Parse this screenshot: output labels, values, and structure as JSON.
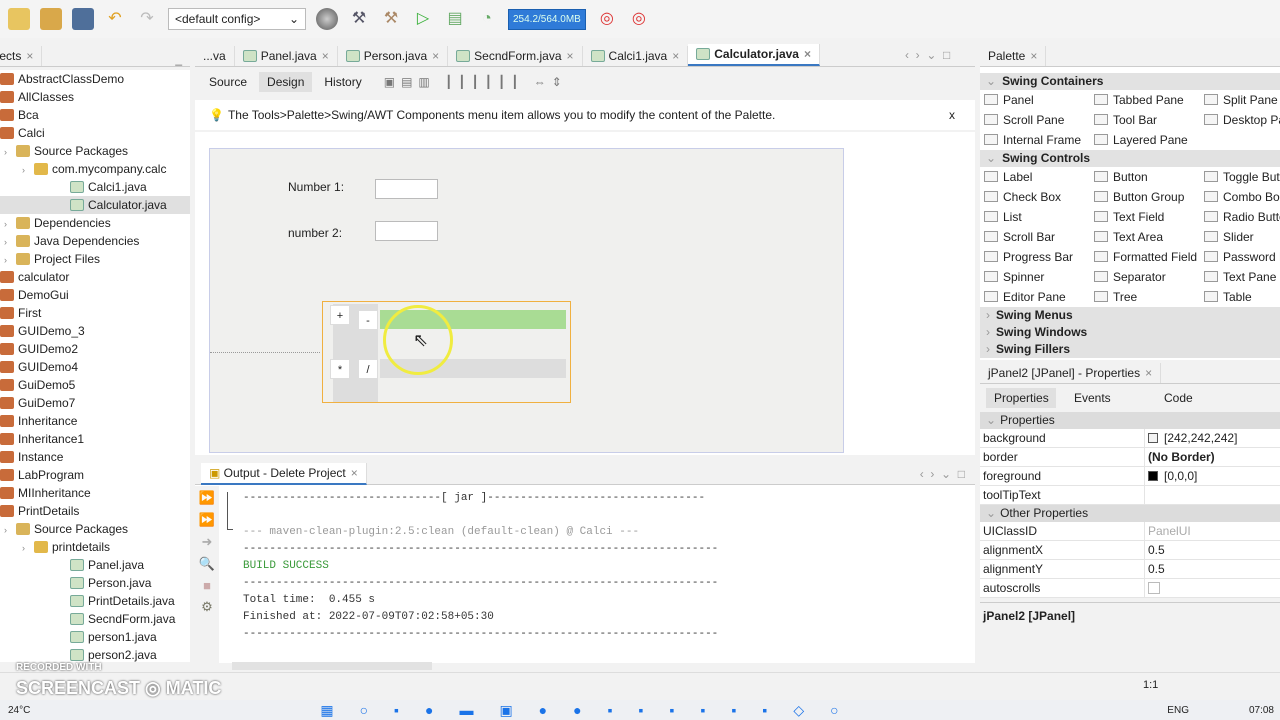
{
  "toolbar": {
    "config": "<default config>",
    "memory": "254.2/564.0MB",
    "icons": [
      "new-project-icon",
      "open-project-icon",
      "save-all-icon",
      "undo-icon",
      "redo-icon",
      "globe-icon",
      "build-icon",
      "clean-build-icon",
      "run-icon",
      "debug-icon",
      "profile-icon",
      "gc-icon",
      "profile-snapshot-icon"
    ]
  },
  "projects": {
    "tab": "Projects",
    "items": [
      {
        "label": "AbstractClassDemo",
        "level": 1
      },
      {
        "label": "AllClasses",
        "level": 1
      },
      {
        "label": "Bca",
        "level": 1
      },
      {
        "label": "Calci",
        "level": 1
      },
      {
        "label": "Source Packages",
        "level": 2
      },
      {
        "label": "com.mycompany.calc",
        "level": 3
      },
      {
        "label": "Calci1.java",
        "level": 4
      },
      {
        "label": "Calculator.java",
        "level": 4,
        "selected": true
      },
      {
        "label": "Dependencies",
        "level": 2
      },
      {
        "label": "Java Dependencies",
        "level": 2
      },
      {
        "label": "Project Files",
        "level": 2
      },
      {
        "label": "calculator",
        "level": 1
      },
      {
        "label": "DemoGui",
        "level": 1
      },
      {
        "label": "First",
        "level": 1
      },
      {
        "label": "GUIDemo_3",
        "level": 1
      },
      {
        "label": "GUIDemo2",
        "level": 1
      },
      {
        "label": "GUIDemo4",
        "level": 1
      },
      {
        "label": "GuiDemo5",
        "level": 1
      },
      {
        "label": "GuiDemo7",
        "level": 1
      },
      {
        "label": "Inheritance",
        "level": 1
      },
      {
        "label": "Inheritance1",
        "level": 1
      },
      {
        "label": "Instance",
        "level": 1
      },
      {
        "label": "LabProgram",
        "level": 1
      },
      {
        "label": "MIInheritance",
        "level": 1
      },
      {
        "label": "PrintDetails",
        "level": 1
      },
      {
        "label": "Source Packages",
        "level": 2
      },
      {
        "label": "printdetails",
        "level": 3
      },
      {
        "label": "Panel.java",
        "level": 4
      },
      {
        "label": "Person.java",
        "level": 4
      },
      {
        "label": "PrintDetails.java",
        "level": 4
      },
      {
        "label": "SecndForm.java",
        "level": 4
      },
      {
        "label": "person1.java",
        "level": 4
      },
      {
        "label": "person2.java",
        "level": 4
      }
    ]
  },
  "editor": {
    "tabs": [
      "...va",
      "Panel.java",
      "Person.java",
      "SecndForm.java",
      "Calci1.java",
      "Calculator.java"
    ],
    "active_tab": "Calculator.java",
    "views": [
      "Source",
      "Design",
      "History"
    ],
    "hint": "The Tools>Palette>Swing/AWT Components menu item allows you to modify the content of the Palette.",
    "hint_close": "x",
    "form": {
      "label1": "Number 1:",
      "label2": "number 2:",
      "buttons": [
        "+",
        "-",
        "*",
        "/"
      ]
    }
  },
  "output": {
    "title": "Output - Delete Project",
    "lines": [
      {
        "text": "------------------------------[ jar ]---------------------------------",
        "color": "#333"
      },
      {
        "text": "",
        "color": "#333"
      },
      {
        "text": "--- maven-clean-plugin:2.5:clean (default-clean) @ Calci ---",
        "color": "#999"
      },
      {
        "text": "------------------------------------------------------------------------",
        "color": "#333"
      },
      {
        "text": "BUILD SUCCESS",
        "color": "#3a9a3a"
      },
      {
        "text": "------------------------------------------------------------------------",
        "color": "#333"
      },
      {
        "text": "Total time:  0.455 s",
        "color": "#333"
      },
      {
        "text": "Finished at: 2022-07-09T07:02:58+05:30",
        "color": "#333"
      },
      {
        "text": "------------------------------------------------------------------------",
        "color": "#333"
      }
    ]
  },
  "palette": {
    "tab": "Palette",
    "categories": [
      {
        "name": "Swing Containers",
        "open": true,
        "items": [
          "Panel",
          "Tabbed Pane",
          "Split Pane",
          "Scroll Pane",
          "Tool Bar",
          "Desktop Pane",
          "Internal Frame",
          "Layered Pane",
          ""
        ]
      },
      {
        "name": "Swing Controls",
        "open": true,
        "items": [
          "Label",
          "Button",
          "Toggle Button",
          "Check Box",
          "Button Group",
          "Combo Box",
          "List",
          "Text Field",
          "Radio Button",
          "Scroll Bar",
          "Text Area",
          "Slider",
          "Progress Bar",
          "Formatted Field",
          "Password Field",
          "Spinner",
          "Separator",
          "Text Pane",
          "Editor Pane",
          "Tree",
          "Table"
        ]
      },
      {
        "name": "Swing Menus",
        "open": false,
        "items": []
      },
      {
        "name": "Swing Windows",
        "open": false,
        "items": []
      },
      {
        "name": "Swing Fillers",
        "open": false,
        "items": []
      }
    ]
  },
  "properties": {
    "title": "jPanel2 [JPanel] - Properties",
    "tabs": [
      "Properties",
      "Events",
      "Code"
    ],
    "sections": [
      {
        "name": "Properties",
        "rows": [
          {
            "k": "background",
            "v": "[242,242,242]",
            "swatch": "#f2f2f2"
          },
          {
            "k": "border",
            "v": "(No Border)",
            "bold": true
          },
          {
            "k": "foreground",
            "v": "[0,0,0]",
            "swatch": "#000000"
          },
          {
            "k": "toolTipText",
            "v": ""
          }
        ]
      },
      {
        "name": "Other Properties",
        "rows": [
          {
            "k": "UIClassID",
            "v": "PanelUI",
            "muted": true
          },
          {
            "k": "alignmentX",
            "v": "0.5"
          },
          {
            "k": "alignmentY",
            "v": "0.5"
          },
          {
            "k": "autoscrolls",
            "v": "",
            "checkbox": true
          }
        ]
      }
    ],
    "description": "jPanel2 [JPanel]"
  },
  "status": {
    "position": "1:1"
  },
  "watermark": {
    "line1": "RECORDED WITH",
    "line2": "SCREENCAST",
    "line3": "MATIC"
  },
  "taskbar": {
    "weather": "24°C",
    "lang": "ENG",
    "time": "07:08"
  }
}
